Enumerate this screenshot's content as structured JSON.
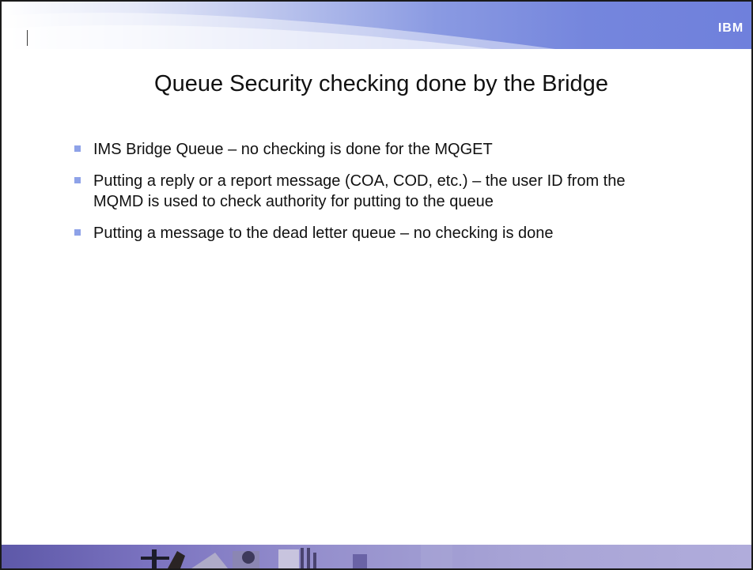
{
  "header": {
    "logo_text": "IBM"
  },
  "slide": {
    "title": "Queue Security checking done by the Bridge",
    "bullets": [
      {
        "text": "IMS Bridge Queue – no checking is done for the MQGET"
      },
      {
        "text": "Putting a reply or a report message (COA, COD, etc.) – the user ID from the MQMD is used to check authority for putting to the queue"
      },
      {
        "text": "Putting a message to the dead letter queue – no checking is done"
      }
    ]
  },
  "colors": {
    "header_gradient_end": "#6f80dc",
    "bullet_marker": "#8ea2e8",
    "footer_band": "#7b73c0"
  }
}
